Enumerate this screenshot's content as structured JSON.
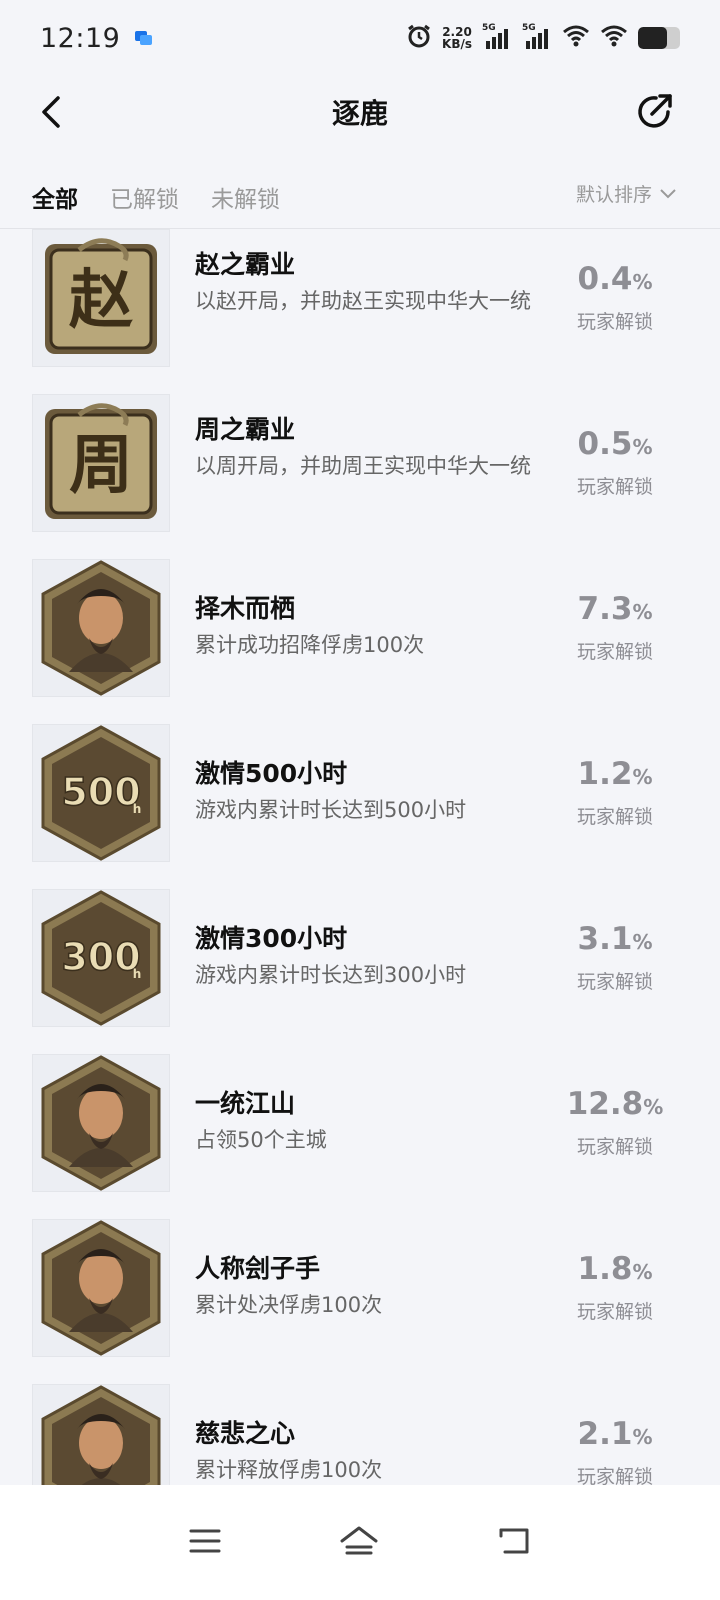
{
  "status": {
    "time": "12:19",
    "net_speed_value": "2.20",
    "net_speed_unit": "KB/s",
    "sim1_label": "5G",
    "sim2_label": "5G"
  },
  "header": {
    "title": "逐鹿"
  },
  "tabs": [
    {
      "label": "全部",
      "active": true
    },
    {
      "label": "已解锁",
      "active": false
    },
    {
      "label": "未解锁",
      "active": false
    }
  ],
  "sort": {
    "label": "默认排序"
  },
  "achievements": [
    {
      "name": "赵之霸业",
      "desc": "以赵开局，并助赵王实现中华大一统",
      "percent": "0.4",
      "unlock_label": "玩家解锁",
      "badge_glyph": "赵",
      "badge_type": "square-gold"
    },
    {
      "name": "周之霸业",
      "desc": "以周开局，并助周王实现中华大一统",
      "percent": "0.5",
      "unlock_label": "玩家解锁",
      "badge_glyph": "周",
      "badge_type": "square-gold"
    },
    {
      "name": "择木而栖",
      "desc": "累计成功招降俘虏100次",
      "percent": "7.3",
      "unlock_label": "玩家解锁",
      "badge_glyph": "",
      "badge_type": "hex-portrait"
    },
    {
      "name": "激情500小时",
      "desc": "游戏内累计时长达到500小时",
      "percent": "1.2",
      "unlock_label": "玩家解锁",
      "badge_glyph": "500",
      "badge_type": "hex-number"
    },
    {
      "name": "激情300小时",
      "desc": "游戏内累计时长达到300小时",
      "percent": "3.1",
      "unlock_label": "玩家解锁",
      "badge_glyph": "300",
      "badge_type": "hex-number"
    },
    {
      "name": "一统江山",
      "desc": "占领50个主城",
      "percent": "12.8",
      "unlock_label": "玩家解锁",
      "badge_glyph": "",
      "badge_type": "hex-portrait"
    },
    {
      "name": "人称刽子手",
      "desc": "累计处决俘虏100次",
      "percent": "1.8",
      "unlock_label": "玩家解锁",
      "badge_glyph": "",
      "badge_type": "hex-portrait"
    },
    {
      "name": "慈悲之心",
      "desc": "累计释放俘虏100次",
      "percent": "2.1",
      "unlock_label": "玩家解锁",
      "badge_glyph": "",
      "badge_type": "hex-portrait"
    }
  ],
  "percent_sign": "%",
  "badge_small_letter": "h",
  "colors": {
    "background": "#f4f5f9",
    "badge_gold": "#b8a77a",
    "badge_dark": "#5b4a32",
    "muted_text": "#8e8e94"
  },
  "icons": {
    "back": "chevron-left-icon",
    "share": "share-arrow-icon",
    "sort": "chevron-down-icon",
    "nav_menu": "menu-icon",
    "nav_home": "home-icon",
    "nav_back": "back-icon"
  }
}
